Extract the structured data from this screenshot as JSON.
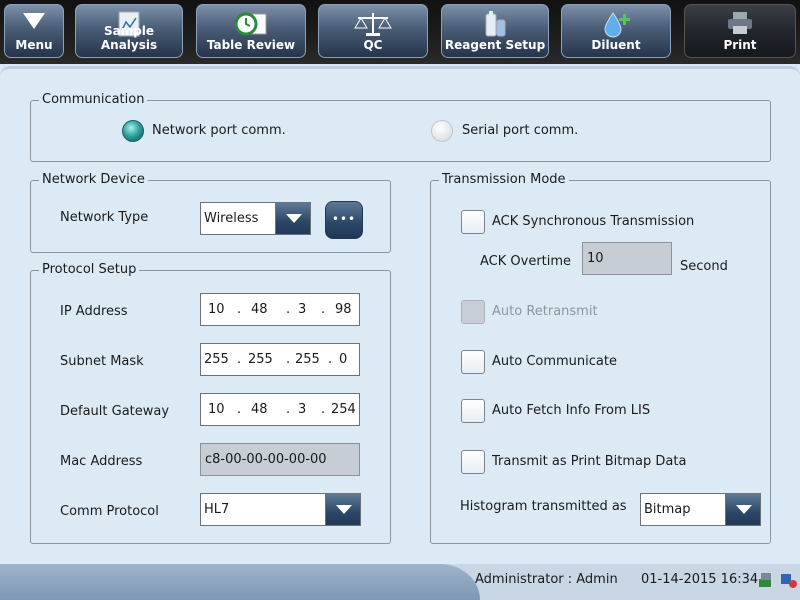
{
  "toolbar": {
    "menu": "Menu",
    "sample_analysis": "Sample Analysis",
    "table_review": "Table Review",
    "qc": "QC",
    "reagent_setup": "Reagent Setup",
    "diluent": "Diluent",
    "print": "Print"
  },
  "communication": {
    "title": "Communication",
    "network_port": "Network port comm.",
    "serial_port": "Serial port comm.",
    "selected": "network"
  },
  "network_device": {
    "title": "Network Device",
    "network_type_label": "Network Type",
    "network_type_value": "Wireless"
  },
  "protocol_setup": {
    "title": "Protocol Setup",
    "ip_label": "IP Address",
    "ip": [
      "10",
      "48",
      "3",
      "98"
    ],
    "subnet_label": "Subnet Mask",
    "subnet": [
      "255",
      "255",
      "255",
      "0"
    ],
    "gateway_label": "Default Gateway",
    "gateway": [
      "10",
      "48",
      "3",
      "254"
    ],
    "mac_label": "Mac Address",
    "mac": "c8-00-00-00-00-00",
    "comm_protocol_label": "Comm Protocol",
    "comm_protocol": "HL7"
  },
  "transmission_mode": {
    "title": "Transmission Mode",
    "ack_sync": "ACK Synchronous Transmission",
    "ack_overtime_label": "ACK Overtime",
    "ack_overtime_value": "10",
    "second": "Second",
    "auto_retransmit": "Auto Retransmit",
    "auto_communicate": "Auto Communicate",
    "auto_fetch": "Auto Fetch Info From LIS",
    "transmit_bitmap": "Transmit as Print Bitmap Data",
    "histogram_label": "Histogram transmitted as",
    "histogram_value": "Bitmap"
  },
  "status": {
    "user": "Administrator : Admin",
    "datetime": "01-14-2015 16:34"
  }
}
